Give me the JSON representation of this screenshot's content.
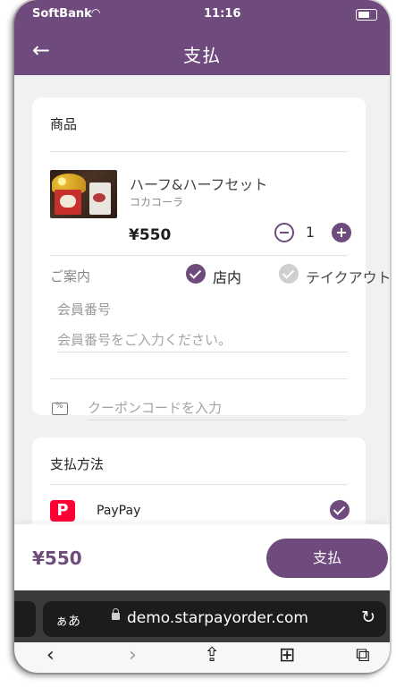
{
  "status_bar": {
    "carrier": "SoftBank",
    "time": "11:16"
  },
  "header": {
    "title": "支払",
    "back_icon": "arrow-left-icon"
  },
  "order_card": {
    "section_title": "商品",
    "item": {
      "name": "ハーフ&ハーフセット",
      "option": "コカコーラ",
      "price": "¥550",
      "quantity": "1"
    },
    "guide_label": "ご案内",
    "dining_options": [
      {
        "label": "店内",
        "selected": true
      },
      {
        "label": "テイクアウト",
        "selected": false
      }
    ],
    "member_label": "会員番号",
    "member_placeholder": "会員番号をご入力ください。",
    "coupon_placeholder": "クーポンコードを入力"
  },
  "payment_card": {
    "section_title": "支払方法",
    "method": {
      "name": "PayPay",
      "selected": true
    }
  },
  "footer": {
    "total": "¥550",
    "pay_label": "支払"
  },
  "browser": {
    "aa_label": "ぁあ",
    "url": "demo.starpayorder.com"
  },
  "colors": {
    "brand": "#6e4b7c",
    "paypay_red": "#ff0033"
  }
}
